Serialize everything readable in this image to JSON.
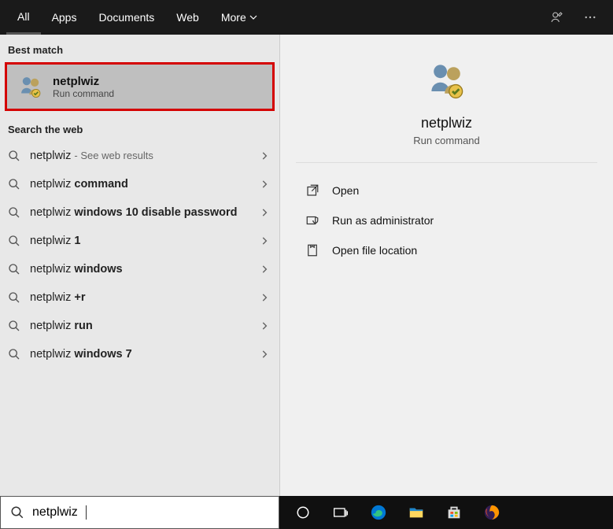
{
  "tabs": {
    "all": "All",
    "apps": "Apps",
    "documents": "Documents",
    "web": "Web",
    "more": "More"
  },
  "sections": {
    "best_match": "Best match",
    "search_web": "Search the web"
  },
  "best_match": {
    "title": "netplwiz",
    "subtitle": "Run command"
  },
  "web_results": [
    {
      "prefix": "netplwiz",
      "bold": "",
      "suffix": "- See web results"
    },
    {
      "prefix": "netplwiz ",
      "bold": "command",
      "suffix": ""
    },
    {
      "prefix": "netplwiz ",
      "bold": "windows 10 disable password",
      "suffix": ""
    },
    {
      "prefix": "netplwiz ",
      "bold": "1",
      "suffix": ""
    },
    {
      "prefix": "netplwiz ",
      "bold": "windows",
      "suffix": ""
    },
    {
      "prefix": "netplwiz ",
      "bold": "+r",
      "suffix": ""
    },
    {
      "prefix": "netplwiz ",
      "bold": "run",
      "suffix": ""
    },
    {
      "prefix": "netplwiz ",
      "bold": "windows 7",
      "suffix": ""
    }
  ],
  "detail": {
    "title": "netplwiz",
    "subtitle": "Run command"
  },
  "actions": {
    "open": "Open",
    "admin": "Run as administrator",
    "location": "Open file location"
  },
  "search_value": "netplwiz"
}
